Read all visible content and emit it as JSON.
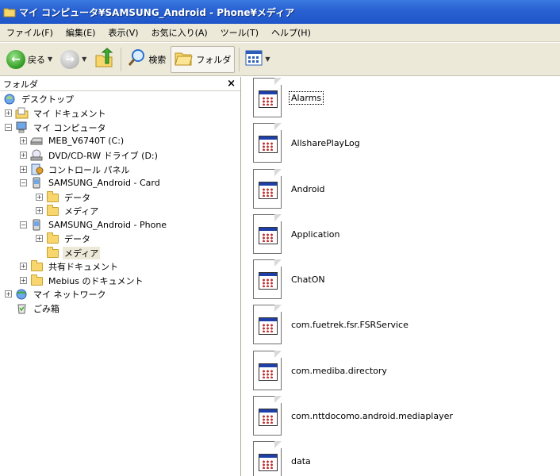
{
  "window": {
    "title": "マイ コンピュータ¥SAMSUNG_Android - Phone¥メディア"
  },
  "menubar": {
    "items": [
      "ファイル(F)",
      "編集(E)",
      "表示(V)",
      "お気に入り(A)",
      "ツール(T)",
      "ヘルプ(H)"
    ]
  },
  "toolbar": {
    "back_label": "戻る",
    "search_label": "検索",
    "folders_label": "フォルダ",
    "icons": {
      "back": "back-arrow-icon",
      "forward": "forward-arrow-icon",
      "up": "up-folder-icon",
      "search": "search-icon",
      "folders": "folders-icon",
      "views": "views-icon"
    }
  },
  "folder_pane": {
    "title": "フォルダ",
    "close": "×",
    "tree": [
      {
        "label": "デスクトップ",
        "icon": "desktop-icon",
        "expander": ""
      },
      {
        "label": "マイ ドキュメント",
        "icon": "my-documents-icon",
        "expander": "+"
      },
      {
        "label": "マイ コンピュータ",
        "icon": "my-computer-icon",
        "expander": "−"
      },
      {
        "label": "MEB_V6740T (C:)",
        "icon": "hard-drive-icon",
        "expander": "+"
      },
      {
        "label": "DVD/CD-RW ドライブ (D:)",
        "icon": "dvd-drive-icon",
        "expander": "+"
      },
      {
        "label": "コントロール パネル",
        "icon": "control-panel-icon",
        "expander": "+"
      },
      {
        "label": "SAMSUNG_Android - Card",
        "icon": "device-icon",
        "expander": "−"
      },
      {
        "label": "データ",
        "icon": "folder-icon",
        "expander": "+"
      },
      {
        "label": "メディア",
        "icon": "folder-icon",
        "expander": "+"
      },
      {
        "label": "SAMSUNG_Android - Phone",
        "icon": "device-icon",
        "expander": "−"
      },
      {
        "label": "データ",
        "icon": "folder-icon",
        "expander": "+"
      },
      {
        "label": "メディア",
        "icon": "folder-icon",
        "expander": ""
      },
      {
        "label": "共有ドキュメント",
        "icon": "folder-icon",
        "expander": "+"
      },
      {
        "label": "Mebius のドキュメント",
        "icon": "folder-icon",
        "expander": "+"
      },
      {
        "label": "マイ ネットワーク",
        "icon": "network-icon",
        "expander": "+"
      },
      {
        "label": "ごみ箱",
        "icon": "recycle-bin-icon",
        "expander": ""
      }
    ]
  },
  "content": {
    "files": [
      "Alarms",
      "AllsharePlayLog",
      "Android",
      "Application",
      "ChatON",
      "com.fuetrek.fsr.FSRService",
      "com.mediba.directory",
      "com.nttdocomo.android.mediaplayer",
      "data"
    ]
  },
  "colors": {
    "titlebar": "#2a62d4",
    "chrome": "#ece9d8",
    "folder": "#f7d66e"
  }
}
